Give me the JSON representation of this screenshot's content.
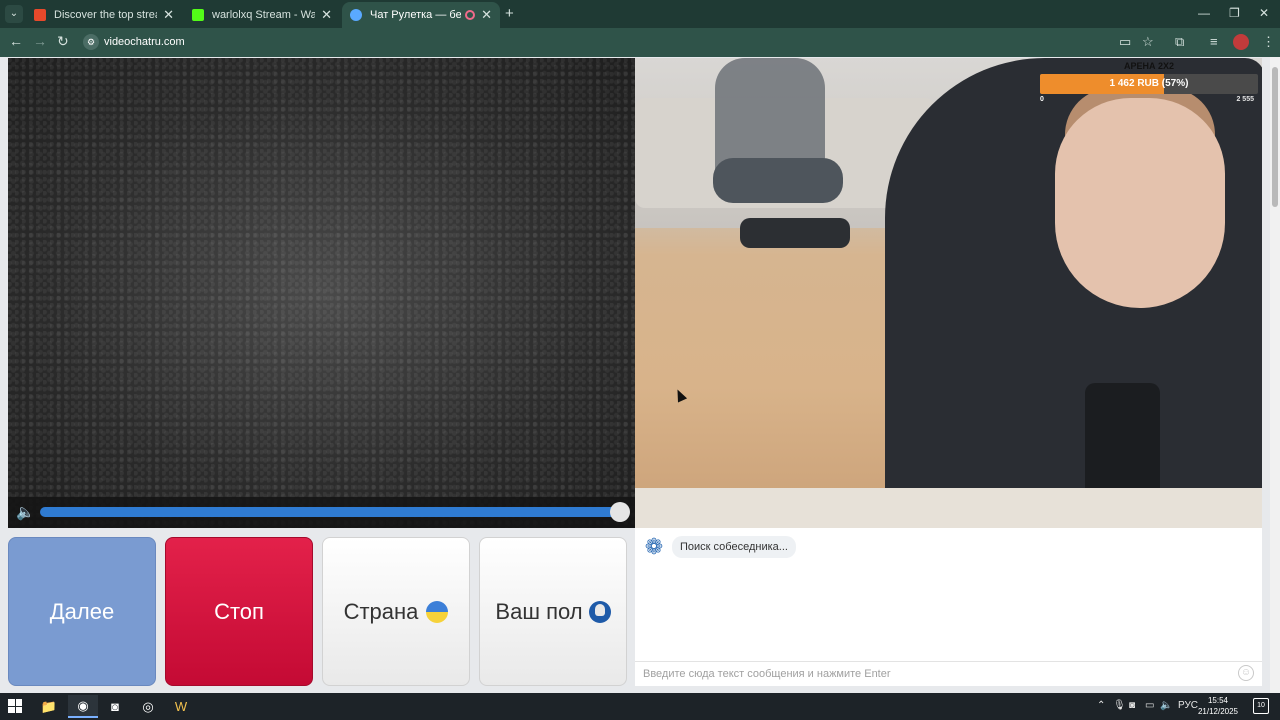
{
  "browser": {
    "tabs": [
      {
        "title": "Discover the top streamed mu",
        "icon": "music-icon",
        "color": "#e8492b"
      },
      {
        "title": "warlolxq Stream - Watch Live o",
        "icon": "kick-icon",
        "color": "#53fc18"
      },
      {
        "title": "Чат Рулетка — бесплатный",
        "icon": "chat-roulette-icon",
        "color": "#5aa9ff"
      }
    ],
    "new_tab": "+",
    "url": "videochatru.com"
  },
  "video": {
    "donation": {
      "title": "АРЕНА 2X2",
      "text": "1 462 RUB (57%)",
      "progress_fraction": 0.57,
      "min": "0",
      "max": "2 555"
    },
    "volume_fraction": 1.0
  },
  "buttons": {
    "next": "Далее",
    "stop": "Стоп",
    "country": "Страна",
    "gender": "Ваш пол"
  },
  "chat": {
    "status": "Поиск собеседника...",
    "input_placeholder": "Введите сюда текст сообщения и нажмите Enter"
  },
  "taskbar": {
    "language": "РУС",
    "time": "15:54",
    "date": "21/12/2025",
    "notifications": "10"
  }
}
